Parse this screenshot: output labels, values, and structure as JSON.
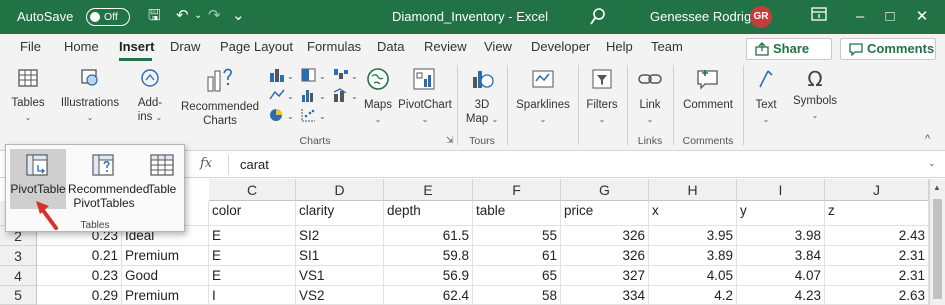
{
  "titlebar": {
    "autosave_label": "AutoSave",
    "autosave_state": "Off",
    "document_title": "Diamond_Inventory  -  Excel",
    "user_name": "Genessee Rodriguez",
    "user_initials": "GR",
    "minimize": "–",
    "maximize": "□",
    "close": "✕",
    "ribbon_display": "⊡",
    "qa_save": "🖫",
    "qa_undo": "↶",
    "qa_redo": "↷",
    "qa_custom": "⌄",
    "qa_dropdown": "⌄"
  },
  "tabs": [
    "File",
    "Home",
    "Insert",
    "Draw",
    "Page Layout",
    "Formulas",
    "Data",
    "Review",
    "View",
    "Developer",
    "Help",
    "Team"
  ],
  "active_tab": "Insert",
  "share_label": "Share",
  "comments_label": "Comments",
  "ribbon": {
    "tables": "Tables",
    "illustrations": "Illustrations",
    "addins": "Add-\nins",
    "recommended_charts": "Recommended\nCharts",
    "maps": "Maps",
    "pivotchart": "PivotChart",
    "map3d": "3D\nMap",
    "sparklines": "Sparklines",
    "filters": "Filters",
    "link": "Link",
    "comment": "Comment",
    "text": "Text",
    "symbols": "Symbols",
    "group_charts": "Charts",
    "group_tours": "Tours",
    "group_links": "Links",
    "group_comments": "Comments",
    "collapse": "^"
  },
  "popup": {
    "pivottable": "PivotTable",
    "recommended_pivottables": "Recommended\nPivotTables",
    "table": "Table",
    "group_label": "Tables"
  },
  "formula_bar": {
    "fx": "fx",
    "value": "carat"
  },
  "sheet": {
    "columns": [
      "C",
      "D",
      "E",
      "F",
      "G",
      "H",
      "I",
      "J"
    ],
    "rows": [
      {
        "num": "",
        "cells": [
          "",
          "color",
          "clarity",
          "depth",
          "table",
          "price",
          "x",
          "y",
          "z"
        ]
      },
      {
        "num": "2",
        "cells": [
          "0.23",
          "Ideal",
          "E",
          "SI2",
          "61.5",
          "55",
          "326",
          "3.95",
          "3.98",
          "2.43"
        ]
      },
      {
        "num": "3",
        "cells": [
          "0.21",
          "Premium",
          "E",
          "SI1",
          "59.8",
          "61",
          "326",
          "3.89",
          "3.84",
          "2.31"
        ]
      },
      {
        "num": "4",
        "cells": [
          "0.23",
          "Good",
          "E",
          "VS1",
          "56.9",
          "65",
          "327",
          "4.05",
          "4.07",
          "2.31"
        ]
      },
      {
        "num": "5",
        "cells": [
          "0.29",
          "Premium",
          "I",
          "VS2",
          "62.4",
          "58",
          "334",
          "4.2",
          "4.23",
          "2.63"
        ]
      }
    ]
  },
  "colors": {
    "excel_green": "#217346",
    "annotation_arrow": "#d9302b"
  }
}
